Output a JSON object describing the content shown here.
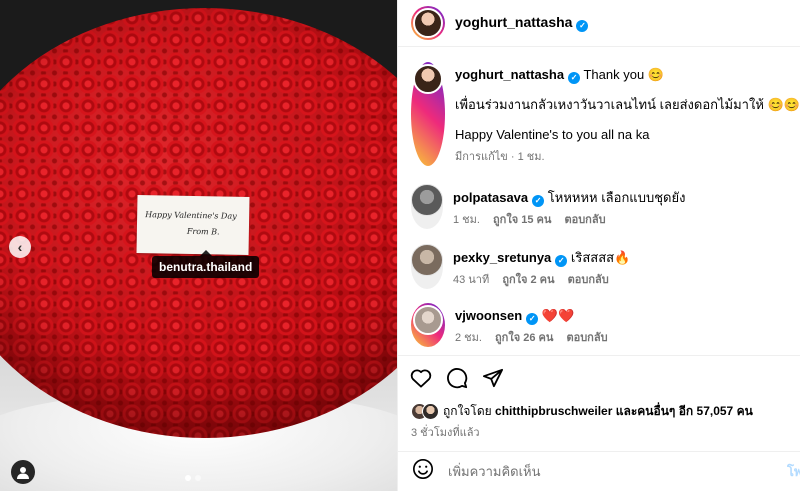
{
  "colors": {
    "accent": "#0095f6",
    "heart": "#e0152a",
    "muted": "#737373"
  },
  "media": {
    "card_line1": "Happy Valentine's Day",
    "card_line2": "From B.",
    "tag_label": "benutra.thailand",
    "prev_icon": "chevron-left-icon",
    "tags_icon": "user-tag-icon",
    "carousel_dots": 2
  },
  "post": {
    "author": "yoghurt_nattasha",
    "caption_first": "Thank you 😊",
    "caption_thai": "เพื่อนร่วมงานกลัวเหงาวันวาเลนไทน์ เลยส่งดอกไม้มาให้ 😊😊",
    "caption_en": "Happy Valentine's to you all na ka",
    "caption_meta": "มีการแก้ไข · 1 ชม."
  },
  "comments": [
    {
      "user": "polpatasava",
      "text": "โหหหหห เลือกแบบชุดยัง",
      "time": "1 ชม.",
      "likes": "ถูกใจ 15 คน",
      "reply": "ตอบกลับ"
    },
    {
      "user": "pexky_sretunya",
      "text": "เริสสสส",
      "emoji": "🔥",
      "time": "43 นาที",
      "likes": "ถูกใจ 2 คน",
      "reply": "ตอบกลับ"
    },
    {
      "user": "vjwoonsen",
      "text": "❤️❤️",
      "time": "2 ชม.",
      "likes": "ถูกใจ 26 คน",
      "reply": "ตอบกลับ"
    }
  ],
  "actions": {
    "like_icon": "heart-icon",
    "comment_icon": "comment-icon",
    "share_icon": "share-icon"
  },
  "likes": {
    "prefix": "ถูกใจโดย",
    "user": "chitthipbruschweiler",
    "middle": "และคนอื่นๆ อีก",
    "count": "57,057",
    "suffix": "คน"
  },
  "post_time": "3 ชั่วโมงที่แล้ว",
  "add_comment": {
    "placeholder": "เพิ่มความคิดเห็น",
    "post_label": "โพสต์",
    "emoji_icon": "emoji-icon"
  }
}
